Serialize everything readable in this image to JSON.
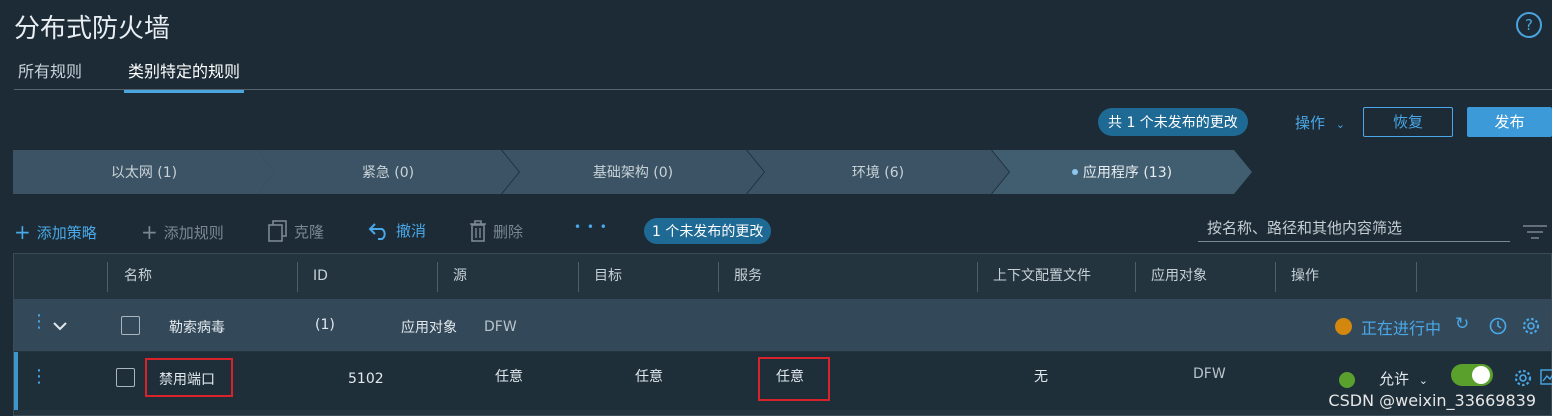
{
  "page": {
    "title": "分布式防火墙",
    "help": "?"
  },
  "tabs": [
    {
      "label": "所有规则"
    },
    {
      "label": "类别特定的规则"
    }
  ],
  "header": {
    "unpublished_pill": "共 1 个未发布的更改",
    "actions_label": "操作",
    "revert_label": "恢复",
    "publish_label": "发布"
  },
  "categories": [
    {
      "label": "以太网 (1)"
    },
    {
      "label": "紧急 (0)"
    },
    {
      "label": "基础架构 (0)"
    },
    {
      "label": "环境 (6)"
    },
    {
      "label": "应用程序 (13)"
    }
  ],
  "toolbar": {
    "add_policy": "添加策略",
    "add_rule": "添加规则",
    "clone": "克隆",
    "undo": "撤消",
    "delete": "删除",
    "more": "• • •",
    "unpublished_pill": "1 个未发布的更改",
    "filter_placeholder": "按名称、路径和其他内容筛选"
  },
  "table": {
    "headers": [
      "名称",
      "ID",
      "源",
      "目标",
      "服务",
      "上下文配置文件",
      "应用对象",
      "操作"
    ],
    "section": {
      "name": "勒索病毒",
      "count": "(1)",
      "applied_to_label": "应用对象",
      "applied_to": "DFW",
      "status": "正在进行中"
    },
    "rule": {
      "name": "禁用端口",
      "id": "5102",
      "source": "任意",
      "destination": "任意",
      "service": "任意",
      "context_profile": "无",
      "applied_to": "DFW",
      "action": "允许",
      "enabled": true
    }
  },
  "watermark": "CSDN @weixin_33669839",
  "colors": {
    "accent": "#4aa8e8",
    "status_orange": "#d3870f",
    "enabled_green": "#5aa02c",
    "highlight_red": "#d9232a"
  }
}
